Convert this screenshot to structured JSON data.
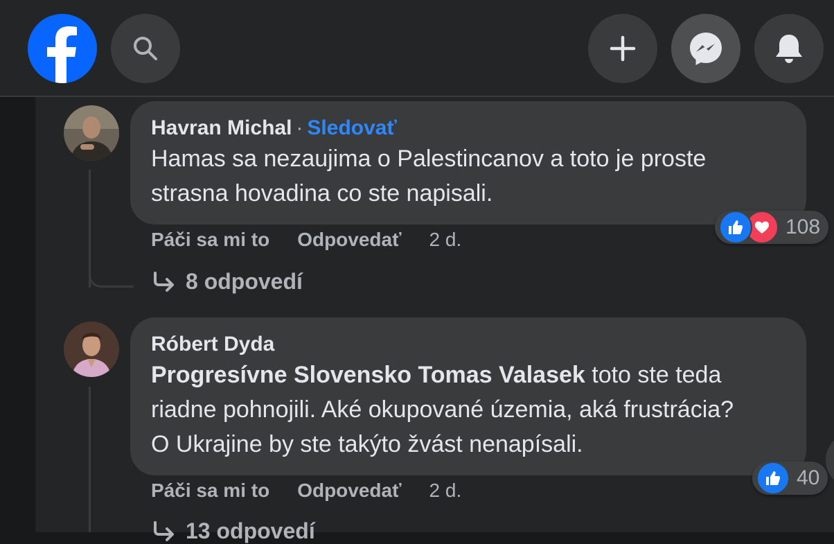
{
  "header": {
    "logo": "facebook-logo",
    "icons": [
      "search-icon",
      "plus-icon",
      "messenger-icon",
      "bell-icon"
    ]
  },
  "comments": [
    {
      "author": "Havran Michal",
      "separator": "·",
      "follow_label": "Sledovať",
      "text_line1": "Hamas sa nezaujima o Palestincanov a toto je proste",
      "text_line2": "strasna hovadina co ste napisali.",
      "like_label": "Páči sa mi to",
      "reply_label": "Odpovedať",
      "time": "2 d.",
      "reaction_count": "108",
      "replies_label": "8 odpovedí"
    },
    {
      "author": "Róbert Dyda",
      "mention": "Progresívne Slovensko Tomas Valasek",
      "text_line1_rest": " toto ste teda",
      "text_line2": "riadne pohnojili. Aké okupované územia, aká frustrácia?",
      "text_line3": "O Ukrajine by ste takýto žvást nenapísali.",
      "like_label": "Páči sa mi to",
      "reply_label": "Odpovedať",
      "time": "2 d.",
      "reaction_count": "40",
      "replies_label": "13 odpovedí"
    }
  ],
  "colors": {
    "background": "#18191a",
    "panel": "#242526",
    "bubble": "#3a3b3c",
    "accent": "#2d88ff",
    "brand": "#0866ff"
  }
}
